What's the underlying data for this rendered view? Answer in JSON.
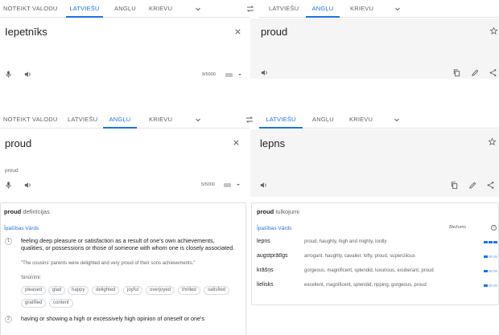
{
  "top": {
    "source_tabs": [
      "NOTEIKT VALODU",
      "LATVIEŠU",
      "ANGĻU",
      "KRIEVU"
    ],
    "source_active": 1,
    "target_tabs": [
      "LATVIEŠU",
      "ANGĻU",
      "KRIEVU"
    ],
    "target_active": 1,
    "input_text": "Iepetnīks",
    "counter": "9/5000",
    "output_text": "proud"
  },
  "bottom": {
    "source_tabs": [
      "NOTEIKT VALODU",
      "LATVIEŠU",
      "ANGĻU",
      "KRIEVU"
    ],
    "source_active": 2,
    "target_tabs": [
      "LATVIEŠU",
      "ANGĻU",
      "KRIEVU"
    ],
    "target_active": 0,
    "input_text": "proud",
    "transliteration": "proud",
    "counter": "5/5000",
    "output_text": "lepns"
  },
  "definitions": {
    "word": "proud",
    "title_suffix": "definīcijas",
    "pos": "Īpašības Vārds",
    "items": [
      {
        "num": "1",
        "text": "feeling deep pleasure or satisfaction as a result of one's own achievements, qualities, or possessions or those of someone with whom one is closely associated.",
        "example": "\"The cousins' parents were delighted and very proud of their sons achievements.\"",
        "synonyms_label": "Sinonīmi:",
        "synonyms": [
          "pleased",
          "glad",
          "happy",
          "delighted",
          "joyful",
          "overjoyed",
          "thrilled",
          "satisfied",
          "gratified",
          "content"
        ]
      },
      {
        "num": "2",
        "text": "having or showing a high or excessively high opinion of oneself or one's"
      }
    ]
  },
  "translations": {
    "word": "proud",
    "title_suffix": "tulkojumi",
    "pos": "Īpašības Vārds",
    "freq_label": "Biežums",
    "rows": [
      {
        "word": "lepns",
        "synonyms": "proud, haughty, high and mighty, lordly",
        "frequency": 3
      },
      {
        "word": "augstprātīgs",
        "synonyms": "arrogant, haughty, cavalier, lofty, proud, supercilious",
        "frequency": 1
      },
      {
        "word": "krāšņs",
        "synonyms": "gorgeous, magnificent, splendid, luxurious, exuberant, proud",
        "frequency": 1
      },
      {
        "word": "lielisks",
        "synonyms": "excellent, magnificent, splendid, ripping, gorgeous, proud",
        "frequency": 1
      }
    ]
  },
  "colors": {
    "accent": "#1a73e8",
    "target_bg": "#f5f5f5",
    "text": "#202124",
    "muted": "#5f6368"
  }
}
